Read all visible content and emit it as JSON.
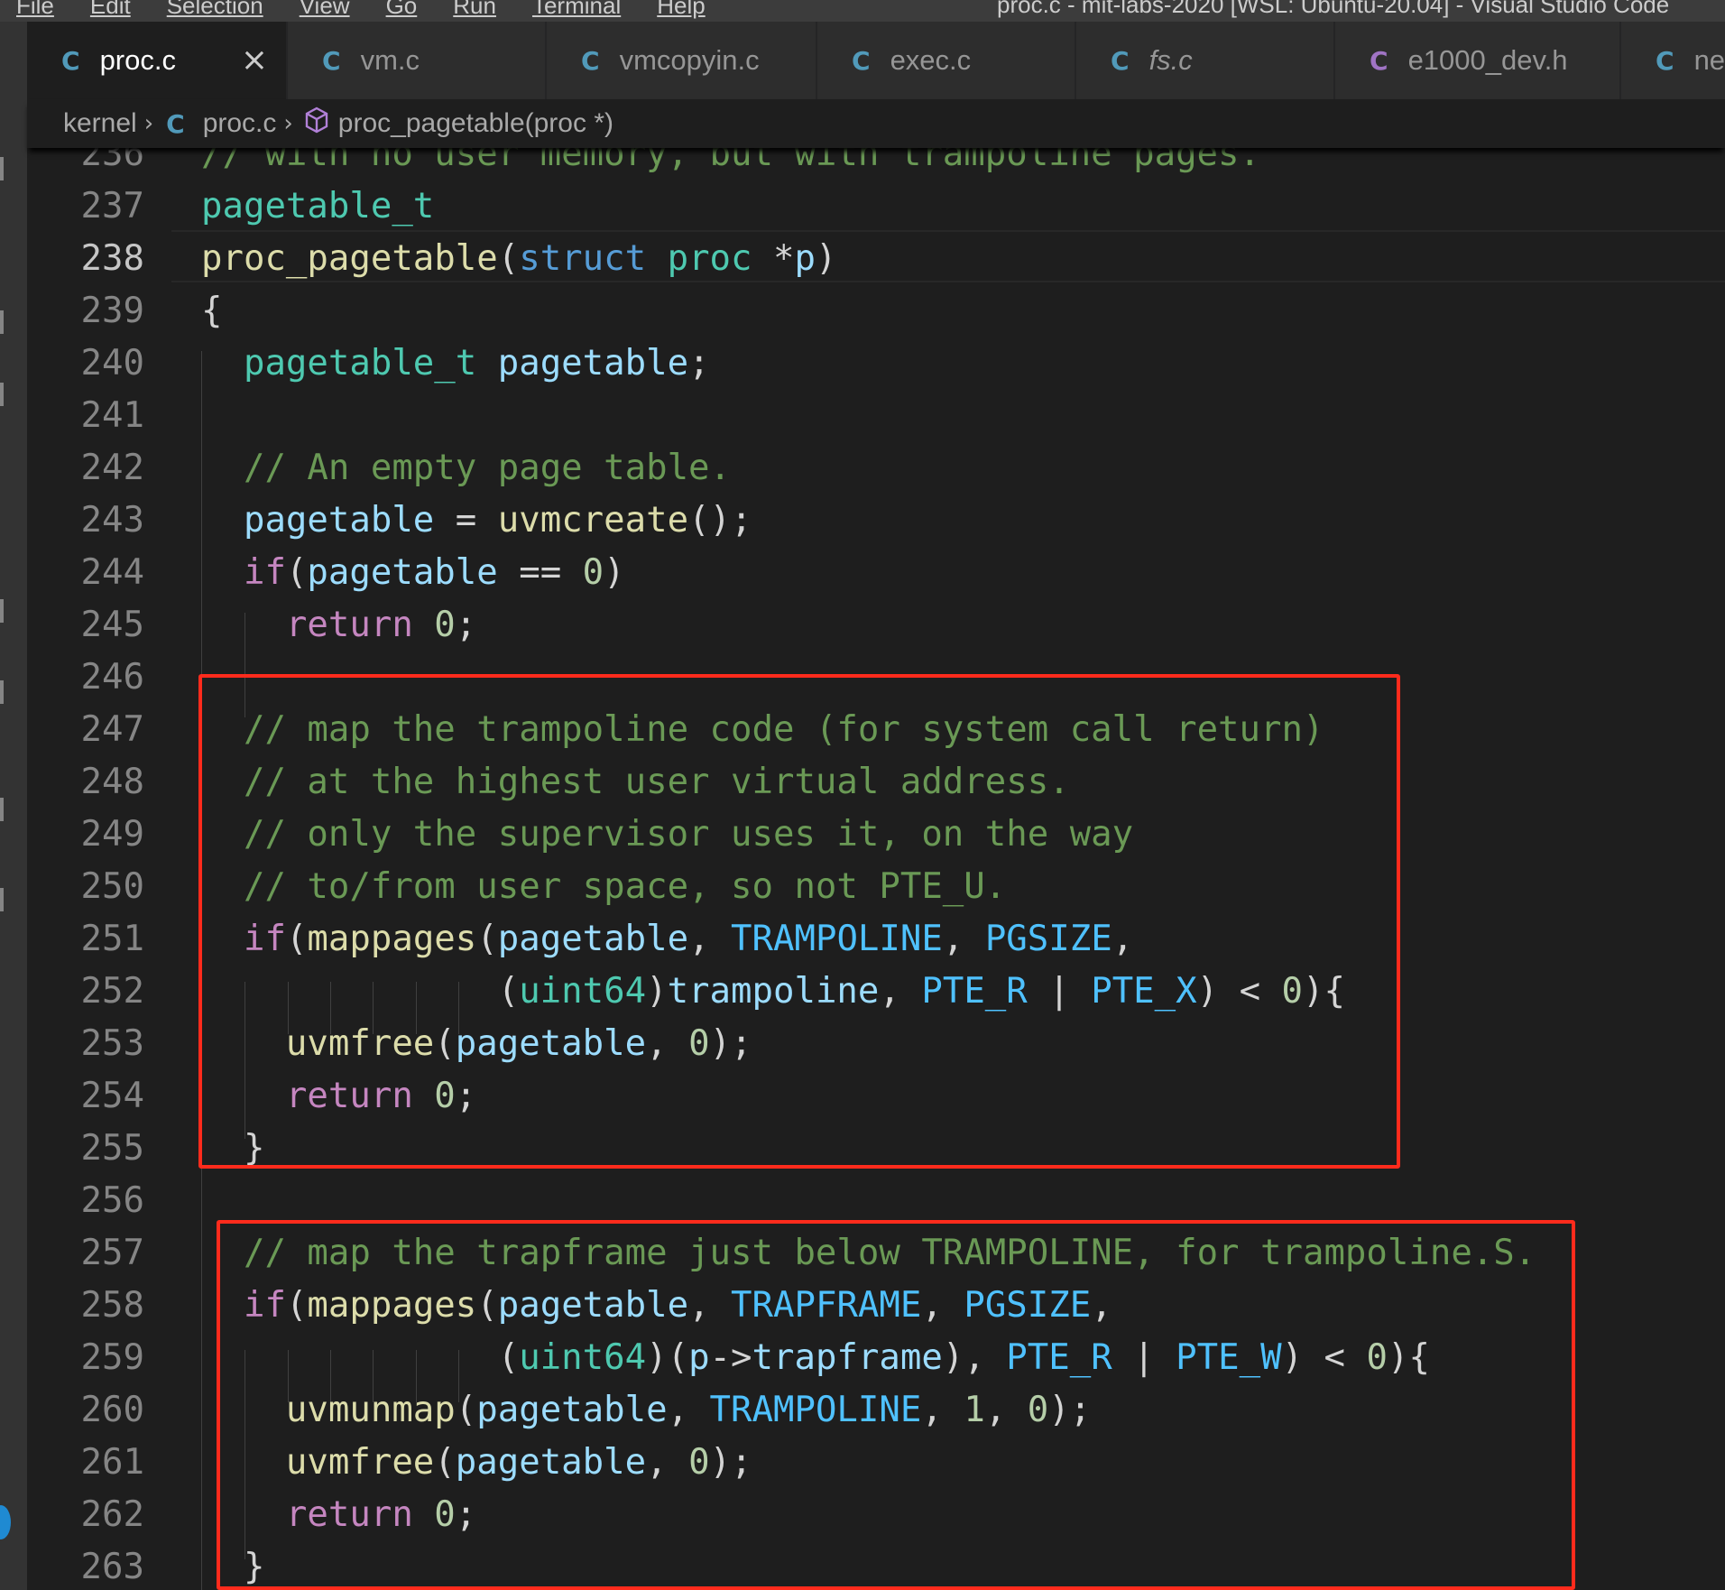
{
  "menubar": {
    "items": [
      "File",
      "Edit",
      "Selection",
      "View",
      "Go",
      "Run",
      "Terminal",
      "Help"
    ],
    "window_title": "proc.c - mit-labs-2020 [WSL: Ubuntu-20.04] - Visual Studio Code"
  },
  "tabs": [
    {
      "label": "proc.c",
      "icon": "c-file-icon",
      "active": true
    },
    {
      "label": "vm.c",
      "icon": "c-file-icon"
    },
    {
      "label": "vmcopyin.c",
      "icon": "c-file-icon"
    },
    {
      "label": "exec.c",
      "icon": "c-file-icon"
    },
    {
      "label": "fs.c",
      "icon": "c-file-icon"
    },
    {
      "label": "e1000_dev.h",
      "icon": "c-header-icon"
    },
    {
      "label": "ne",
      "icon": "c-file-icon"
    }
  ],
  "breadcrumb": {
    "folder": "kernel",
    "file": "proc.c",
    "symbol": "proc_pagetable(proc *)"
  },
  "editor": {
    "current_line": 238,
    "highlight_color": "#ff2b1c",
    "lines": [
      {
        "n": "236",
        "tokens": [
          [
            "cm",
            "// with no user memory, but with trampoline pages."
          ]
        ]
      },
      {
        "n": "237",
        "tokens": [
          [
            "ty",
            "pagetable_t"
          ]
        ]
      },
      {
        "n": "238",
        "tokens": [
          [
            "fn",
            "proc_pagetable"
          ],
          [
            "op",
            "("
          ],
          [
            "kw",
            "struct"
          ],
          [
            "op",
            " "
          ],
          [
            "ty",
            "proc"
          ],
          [
            "op",
            " *"
          ],
          [
            "vr",
            "p"
          ],
          [
            "op",
            ")"
          ]
        ]
      },
      {
        "n": "239",
        "tokens": [
          [
            "op",
            "{"
          ]
        ]
      },
      {
        "n": "240",
        "tokens": [
          [
            "op",
            "  "
          ],
          [
            "ty",
            "pagetable_t"
          ],
          [
            "op",
            " "
          ],
          [
            "vr",
            "pagetable"
          ],
          [
            "op",
            ";"
          ]
        ]
      },
      {
        "n": "241",
        "tokens": []
      },
      {
        "n": "242",
        "tokens": [
          [
            "op",
            "  "
          ],
          [
            "cm",
            "// An empty page table."
          ]
        ]
      },
      {
        "n": "243",
        "tokens": [
          [
            "op",
            "  "
          ],
          [
            "vr",
            "pagetable"
          ],
          [
            "op",
            " = "
          ],
          [
            "fn",
            "uvmcreate"
          ],
          [
            "op",
            "();"
          ]
        ]
      },
      {
        "n": "244",
        "tokens": [
          [
            "op",
            "  "
          ],
          [
            "ct",
            "if"
          ],
          [
            "op",
            "("
          ],
          [
            "vr",
            "pagetable"
          ],
          [
            "op",
            " == "
          ],
          [
            "nm",
            "0"
          ],
          [
            "op",
            ")"
          ]
        ]
      },
      {
        "n": "245",
        "tokens": [
          [
            "op",
            "    "
          ],
          [
            "ct",
            "return"
          ],
          [
            "op",
            " "
          ],
          [
            "nm",
            "0"
          ],
          [
            "op",
            ";"
          ]
        ]
      },
      {
        "n": "246",
        "tokens": []
      },
      {
        "n": "247",
        "tokens": [
          [
            "op",
            "  "
          ],
          [
            "cm",
            "// map the trampoline code (for system call return)"
          ]
        ]
      },
      {
        "n": "248",
        "tokens": [
          [
            "op",
            "  "
          ],
          [
            "cm",
            "// at the highest user virtual address."
          ]
        ]
      },
      {
        "n": "249",
        "tokens": [
          [
            "op",
            "  "
          ],
          [
            "cm",
            "// only the supervisor uses it, on the way"
          ]
        ]
      },
      {
        "n": "250",
        "tokens": [
          [
            "op",
            "  "
          ],
          [
            "cm",
            "// to/from user space, so not PTE_U."
          ]
        ]
      },
      {
        "n": "251",
        "tokens": [
          [
            "op",
            "  "
          ],
          [
            "ct",
            "if"
          ],
          [
            "op",
            "("
          ],
          [
            "fn",
            "mappages"
          ],
          [
            "op",
            "("
          ],
          [
            "vr",
            "pagetable"
          ],
          [
            "op",
            ", "
          ],
          [
            "mc",
            "TRAMPOLINE"
          ],
          [
            "op",
            ", "
          ],
          [
            "mc",
            "PGSIZE"
          ],
          [
            "op",
            ","
          ]
        ]
      },
      {
        "n": "252",
        "tokens": [
          [
            "op",
            "              ("
          ],
          [
            "ty",
            "uint64"
          ],
          [
            "op",
            ")"
          ],
          [
            "vr",
            "trampoline"
          ],
          [
            "op",
            ", "
          ],
          [
            "mc",
            "PTE_R"
          ],
          [
            "op",
            " | "
          ],
          [
            "mc",
            "PTE_X"
          ],
          [
            "op",
            ") < "
          ],
          [
            "nm",
            "0"
          ],
          [
            "op",
            "){"
          ]
        ]
      },
      {
        "n": "253",
        "tokens": [
          [
            "op",
            "    "
          ],
          [
            "fn",
            "uvmfree"
          ],
          [
            "op",
            "("
          ],
          [
            "vr",
            "pagetable"
          ],
          [
            "op",
            ", "
          ],
          [
            "nm",
            "0"
          ],
          [
            "op",
            ");"
          ]
        ]
      },
      {
        "n": "254",
        "tokens": [
          [
            "op",
            "    "
          ],
          [
            "ct",
            "return"
          ],
          [
            "op",
            " "
          ],
          [
            "nm",
            "0"
          ],
          [
            "op",
            ";"
          ]
        ]
      },
      {
        "n": "255",
        "tokens": [
          [
            "op",
            "  }"
          ]
        ]
      },
      {
        "n": "256",
        "tokens": []
      },
      {
        "n": "257",
        "tokens": [
          [
            "op",
            "  "
          ],
          [
            "cm",
            "// map the trapframe just below TRAMPOLINE, for trampoline.S."
          ]
        ]
      },
      {
        "n": "258",
        "tokens": [
          [
            "op",
            "  "
          ],
          [
            "ct",
            "if"
          ],
          [
            "op",
            "("
          ],
          [
            "fn",
            "mappages"
          ],
          [
            "op",
            "("
          ],
          [
            "vr",
            "pagetable"
          ],
          [
            "op",
            ", "
          ],
          [
            "mc",
            "TRAPFRAME"
          ],
          [
            "op",
            ", "
          ],
          [
            "mc",
            "PGSIZE"
          ],
          [
            "op",
            ","
          ]
        ]
      },
      {
        "n": "259",
        "tokens": [
          [
            "op",
            "              ("
          ],
          [
            "ty",
            "uint64"
          ],
          [
            "op",
            ")("
          ],
          [
            "vr",
            "p"
          ],
          [
            "op",
            "->"
          ],
          [
            "vr",
            "trapframe"
          ],
          [
            "op",
            "), "
          ],
          [
            "mc",
            "PTE_R"
          ],
          [
            "op",
            " | "
          ],
          [
            "mc",
            "PTE_W"
          ],
          [
            "op",
            ") < "
          ],
          [
            "nm",
            "0"
          ],
          [
            "op",
            "){"
          ]
        ]
      },
      {
        "n": "260",
        "tokens": [
          [
            "op",
            "    "
          ],
          [
            "fn",
            "uvmunmap"
          ],
          [
            "op",
            "("
          ],
          [
            "vr",
            "pagetable"
          ],
          [
            "op",
            ", "
          ],
          [
            "mc",
            "TRAMPOLINE"
          ],
          [
            "op",
            ", "
          ],
          [
            "nm",
            "1"
          ],
          [
            "op",
            ", "
          ],
          [
            "nm",
            "0"
          ],
          [
            "op",
            ");"
          ]
        ]
      },
      {
        "n": "261",
        "tokens": [
          [
            "op",
            "    "
          ],
          [
            "fn",
            "uvmfree"
          ],
          [
            "op",
            "("
          ],
          [
            "vr",
            "pagetable"
          ],
          [
            "op",
            ", "
          ],
          [
            "nm",
            "0"
          ],
          [
            "op",
            ");"
          ]
        ]
      },
      {
        "n": "262",
        "tokens": [
          [
            "op",
            "    "
          ],
          [
            "ct",
            "return"
          ],
          [
            "op",
            " "
          ],
          [
            "nm",
            "0"
          ],
          [
            "op",
            ";"
          ]
        ]
      },
      {
        "n": "263",
        "tokens": [
          [
            "op",
            "  }"
          ]
        ]
      }
    ]
  }
}
